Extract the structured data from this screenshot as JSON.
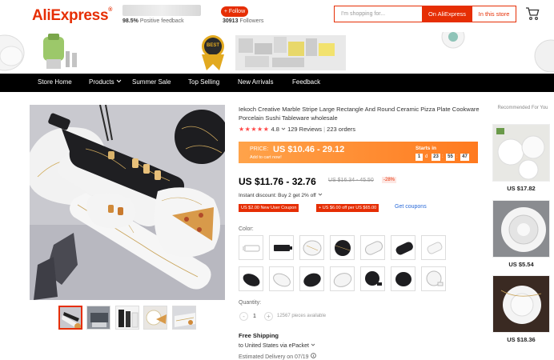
{
  "header": {
    "logo": "AliExpress",
    "logo_mark": "®",
    "feedback_value": "98.5%",
    "feedback_label": "Positive feedback",
    "follow_label": "+ Follow",
    "followers_value": "30913",
    "followers_label": "Followers",
    "search_placeholder": "I'm shopping for...",
    "search_aliexpress_label": "On AliExpress",
    "search_store_label": "In this store"
  },
  "banner": {
    "badge_text": "BEST"
  },
  "nav": {
    "items": [
      "Store Home",
      "Products",
      "Summer Sale",
      "Top Selling",
      "New Arrivals",
      "Feedback"
    ]
  },
  "product": {
    "title": "Iekoch Creative Marble Stripe Large Rectangle And Round Ceramic Pizza Plate Cookware Porcelain Sushi Tableware wholesale",
    "rating_value": "4.8",
    "reviews": "129 Reviews",
    "orders": "223 orders",
    "promo": {
      "label": "PRICE:",
      "price": "US $10.46 - 29.12",
      "sub": "Add to cart now!",
      "starts_in": "Starts in",
      "days": "1",
      "d_label": "d",
      "hours": "23",
      "minutes": "55",
      "seconds": "47"
    },
    "price": "US $11.76 - 32.76",
    "old_price": "US $16.34 - 45.50",
    "discount": "-28%",
    "instant_discount": "Instant discount: Buy 2 get 2% off",
    "coupons": [
      "US $2.00 New User Coupon",
      "+ US $6.00 off per US $65.00"
    ],
    "get_coupons": "Get coupons",
    "color_label": "Color:",
    "quantity_label": "Quantity:",
    "quantity": "1",
    "minus": "-",
    "plus": "+",
    "pieces_available": "12567 pieces available",
    "shipping_title": "Free Shipping",
    "shipping_to": "to United States via ePacket",
    "delivery": "Estimated Delivery on 07/19"
  },
  "recommended": {
    "title": "Recommended For You",
    "prices": [
      "US $17.82",
      "US $5.54",
      "US $18.36"
    ]
  },
  "colors": {
    "brand": "#e62e04",
    "promo_orange": "#ff8a2a",
    "link_blue": "#2a6ad8"
  },
  "icons": [
    "cart-icon",
    "chevron-down-icon",
    "info-icon"
  ]
}
